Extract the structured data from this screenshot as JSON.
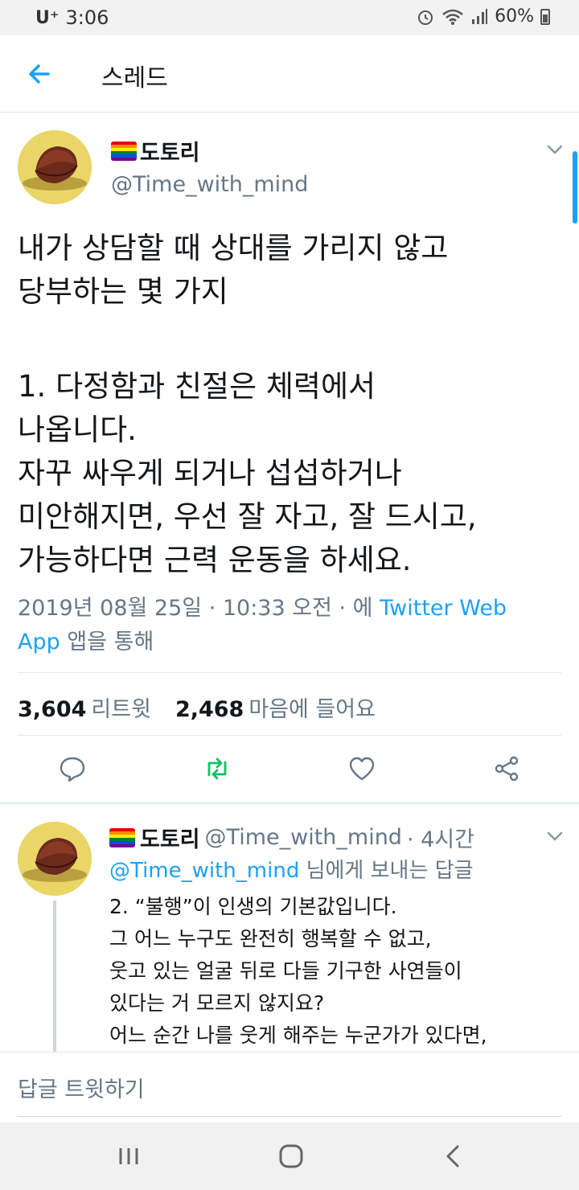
{
  "status_bar": {
    "carrier": "U⁺",
    "time": "3:06",
    "battery": "60%"
  },
  "header": {
    "title": "스레드"
  },
  "tweet": {
    "display_name": "도토리",
    "handle": "@Time_with_mind",
    "lines": [
      "내가 상담할 때 상대를 가리지 않고",
      "당부하는 몇 가지",
      "",
      "1. 다정함과 친절은 체력에서",
      "나옵니다.",
      "자꾸 싸우게 되거나 섭섭하거나",
      "미안해지면, 우선 잘 자고, 잘 드시고,",
      "가능하다면 근력 운동을 하세요."
    ],
    "timestamp": "2019년 08월 25일 · 10:33 오전 · 에",
    "source_link": "Twitter Web",
    "source_link_2": "App",
    "source_suffix": "앱을 통해",
    "retweet_count": "3,604",
    "retweet_label": "리트윗",
    "like_count": "2,468",
    "like_label": "마음에 들어요"
  },
  "reply": {
    "display_name": "도토리",
    "handle": "@Time_with_mind",
    "time": "· 4시간",
    "reply_to_handle": "@Time_with_mind",
    "reply_to_suffix": "님에게 보내는 답글",
    "lines": [
      "2. “불행”이 인생의 기본값입니다.",
      "그 어느 누구도 완전히 행복할 수 없고,",
      "웃고 있는 얼굴 뒤로 다들 기구한 사연들이",
      "있다는 거 모르지 않지요?",
      "어느 순간 나를 웃게 해주는 누군가가 있다면,"
    ]
  },
  "composer": {
    "placeholder": "답글 트윗하기"
  },
  "icons": {
    "back": "arrow-left-icon",
    "chevron": "chevron-down-icon",
    "reply": "comment-icon",
    "retweet": "retweet-icon",
    "like": "heart-icon",
    "share": "share-icon",
    "nav_recent": "recent-apps-icon",
    "nav_home": "home-icon",
    "nav_back": "nav-back-icon"
  },
  "colors": {
    "accent": "#1da1f2",
    "retweet": "#17bf63",
    "muted": "#657786",
    "text": "#14171a"
  }
}
